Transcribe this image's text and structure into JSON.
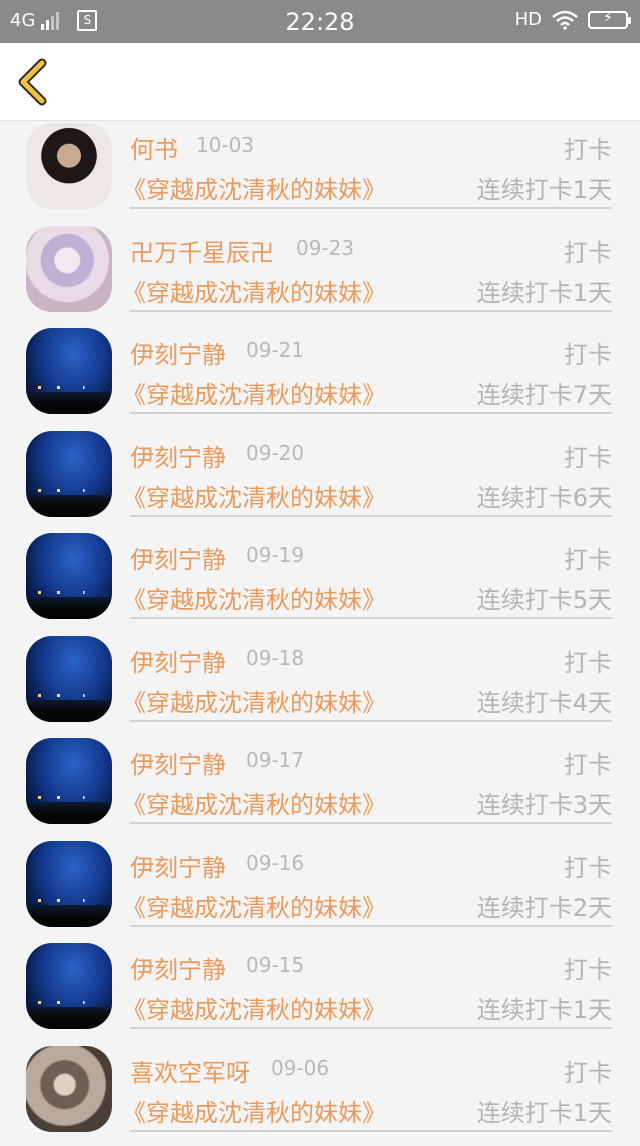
{
  "status_bar": {
    "network": "4G",
    "sim_label": "S",
    "time": "22:28",
    "hd_label": "HD"
  },
  "nav": {
    "back_icon": "chevron-left-icon",
    "accent_color": "#f2c23a"
  },
  "colors": {
    "name": "#ec9a5b",
    "muted": "#b4b4b4"
  },
  "records": [
    {
      "name": "何书",
      "date": "10-03",
      "action": "打卡",
      "book": "《穿越成沈清秋的妹妹》",
      "streak": "连续打卡1天",
      "avatar": "girl-portrait"
    },
    {
      "name": "卍万千星辰卍",
      "date": "09-23",
      "action": "打卡",
      "book": "《穿越成沈清秋的妹妹》",
      "streak": "连续打卡1天",
      "avatar": "anime-portrait"
    },
    {
      "name": "伊刻宁静",
      "date": "09-21",
      "action": "打卡",
      "book": "《穿越成沈清秋的妹妹》",
      "streak": "连续打卡7天",
      "avatar": "night-sky"
    },
    {
      "name": "伊刻宁静",
      "date": "09-20",
      "action": "打卡",
      "book": "《穿越成沈清秋的妹妹》",
      "streak": "连续打卡6天",
      "avatar": "night-sky"
    },
    {
      "name": "伊刻宁静",
      "date": "09-19",
      "action": "打卡",
      "book": "《穿越成沈清秋的妹妹》",
      "streak": "连续打卡5天",
      "avatar": "night-sky"
    },
    {
      "name": "伊刻宁静",
      "date": "09-18",
      "action": "打卡",
      "book": "《穿越成沈清秋的妹妹》",
      "streak": "连续打卡4天",
      "avatar": "night-sky"
    },
    {
      "name": "伊刻宁静",
      "date": "09-17",
      "action": "打卡",
      "book": "《穿越成沈清秋的妹妹》",
      "streak": "连续打卡3天",
      "avatar": "night-sky"
    },
    {
      "name": "伊刻宁静",
      "date": "09-16",
      "action": "打卡",
      "book": "《穿越成沈清秋的妹妹》",
      "streak": "连续打卡2天",
      "avatar": "night-sky"
    },
    {
      "name": "伊刻宁静",
      "date": "09-15",
      "action": "打卡",
      "book": "《穿越成沈清秋的妹妹》",
      "streak": "连续打卡1天",
      "avatar": "night-sky"
    },
    {
      "name": "喜欢空军呀",
      "date": "09-06",
      "action": "打卡",
      "book": "《穿越成沈清秋的妹妹》",
      "streak": "连续打卡1天",
      "avatar": "sketch-portrait"
    }
  ]
}
